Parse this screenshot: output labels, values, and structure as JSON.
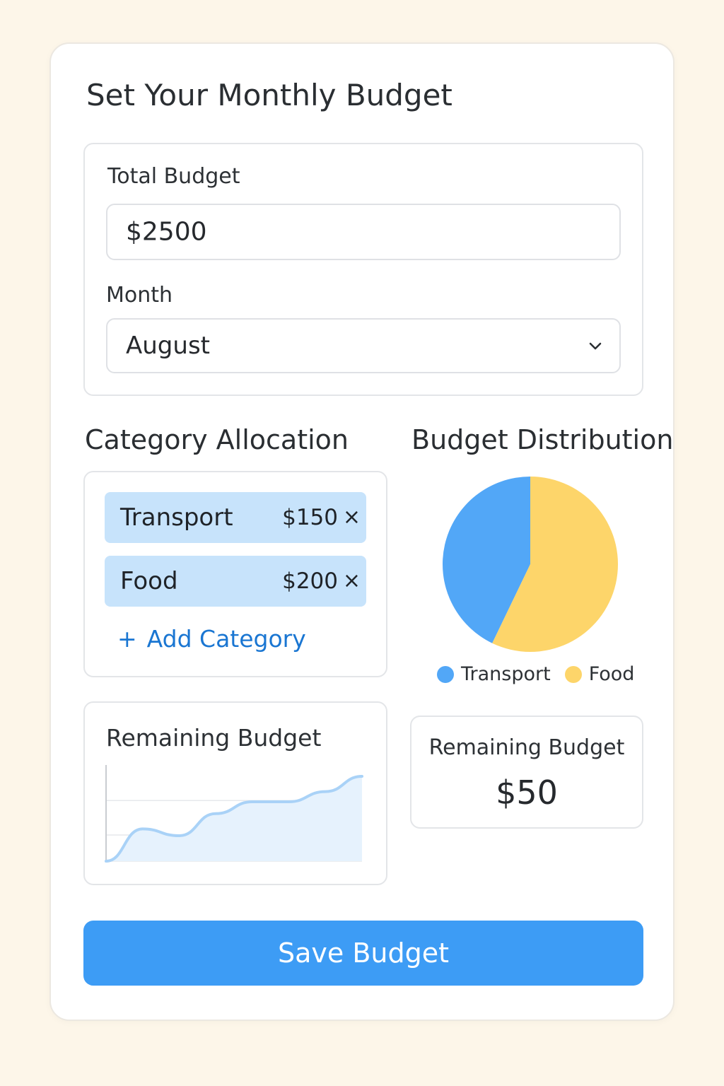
{
  "header": {
    "title": "Set Your Monthly Budget"
  },
  "budget_form": {
    "total_label": "Total Budget",
    "total_value": "$2500",
    "month_label": "Month",
    "month_value": "August"
  },
  "allocation": {
    "title": "Category Allocation",
    "categories": [
      {
        "name": "Transport",
        "amount": "$150",
        "remove": "×"
      },
      {
        "name": "Food",
        "amount": "$200",
        "remove": "×"
      }
    ],
    "add_icon": "+",
    "add_label": "Add Category"
  },
  "distribution": {
    "title": "Budget Distribution",
    "legend": [
      {
        "name": "Transport",
        "color": "#52a7f7"
      },
      {
        "name": "Food",
        "color": "#fdd56a"
      }
    ]
  },
  "remaining_chart": {
    "title": "Remaining Budget"
  },
  "remaining_summary": {
    "label": "Remaining Budget",
    "value": "$50"
  },
  "actions": {
    "save_label": "Save Budget"
  },
  "colors": {
    "accent": "#3d9cf5",
    "link": "#1a76d2",
    "chip": "#c7e3fb",
    "background": "#fdf6e9"
  },
  "chart_data": [
    {
      "type": "pie",
      "title": "Budget Distribution",
      "categories": [
        "Transport",
        "Food"
      ],
      "values": [
        150,
        200
      ],
      "colors": [
        "#52a7f7",
        "#fdd56a"
      ]
    },
    {
      "type": "area",
      "title": "Remaining Budget",
      "x": [
        0,
        1,
        2,
        3,
        4,
        5,
        6,
        7
      ],
      "values": [
        0,
        38,
        30,
        56,
        70,
        70,
        82,
        100
      ],
      "ylim": [
        0,
        110
      ],
      "grid": true
    }
  ]
}
